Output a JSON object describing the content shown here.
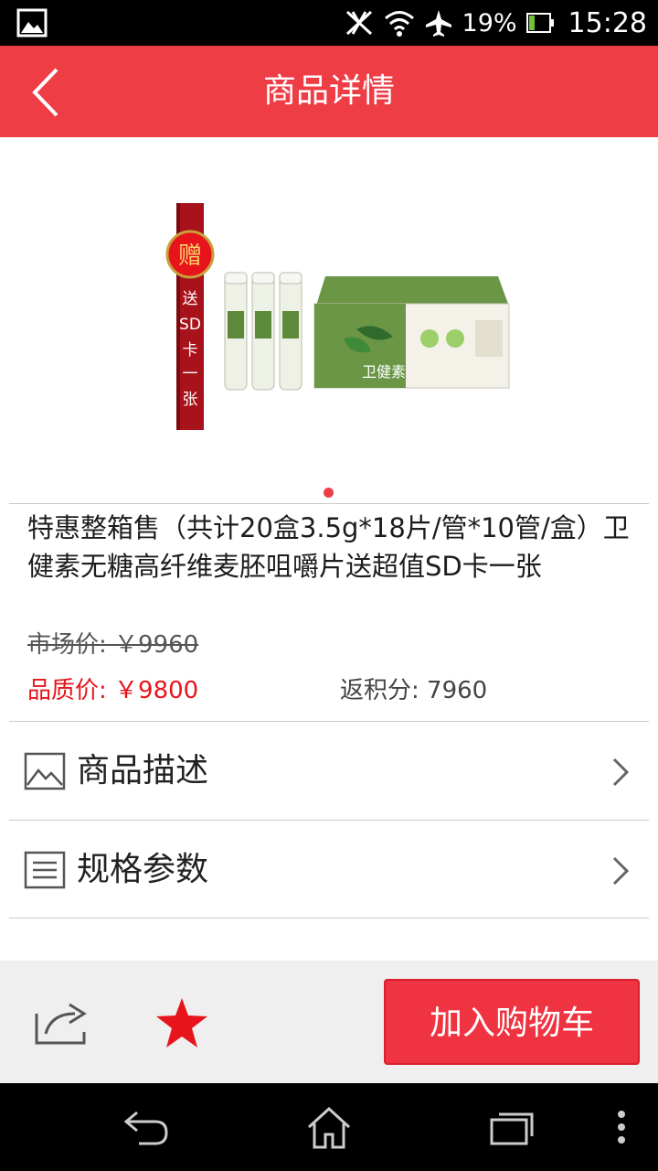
{
  "status_bar": {
    "battery": "19%",
    "time": "15:28"
  },
  "header": {
    "title": "商品详情"
  },
  "gallery": {
    "banner_gift": "赠",
    "banner_text": "送SD卡一张",
    "brand_text": "卫健素"
  },
  "product": {
    "title": "特惠整箱售（共计20盒3.5g*18片/管*10管/盒）卫健素无糖高纤维麦胚咀嚼片送超值SD卡一张",
    "market_price": "市场价: ￥9960",
    "quality_price": "品质价: ￥9800",
    "points": "返积分: 7960"
  },
  "rows": {
    "description": "商品描述",
    "specs": "规格参数"
  },
  "action_bar": {
    "add_to_cart": "加入购物车"
  },
  "colors": {
    "accent": "#ef3d46",
    "price_red": "#e8141c"
  },
  "icons": {
    "back": "chevron-left-icon",
    "description": "image-icon",
    "specs": "list-icon",
    "share": "share-icon",
    "favorite": "star-icon"
  }
}
